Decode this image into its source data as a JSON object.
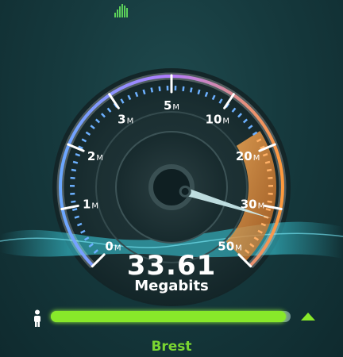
{
  "gauge": {
    "scale_labels": [
      {
        "num": "0",
        "unit": "M"
      },
      {
        "num": "1",
        "unit": "M"
      },
      {
        "num": "2",
        "unit": "M"
      },
      {
        "num": "3",
        "unit": "M"
      },
      {
        "num": "5",
        "unit": "M"
      },
      {
        "num": "10",
        "unit": "M"
      },
      {
        "num": "20",
        "unit": "M"
      },
      {
        "num": "30",
        "unit": "M"
      },
      {
        "num": "50",
        "unit": "M"
      }
    ],
    "needle_value_mbps": 33.61
  },
  "readout": {
    "value": "33.61",
    "unit": "Megabits"
  },
  "progress": {
    "fraction": 0.98
  },
  "server": {
    "name": "Brest"
  },
  "colors": {
    "accent_green": "#88e82a",
    "gauge_blue": "#58a8ff",
    "gauge_purple": "#b06cff",
    "gauge_orange": "#ff9a3c",
    "needle": "#cfeff2"
  },
  "icons": {
    "signal": "signal-bars-icon",
    "person": "person-icon",
    "upload": "upload-triangle-icon"
  }
}
